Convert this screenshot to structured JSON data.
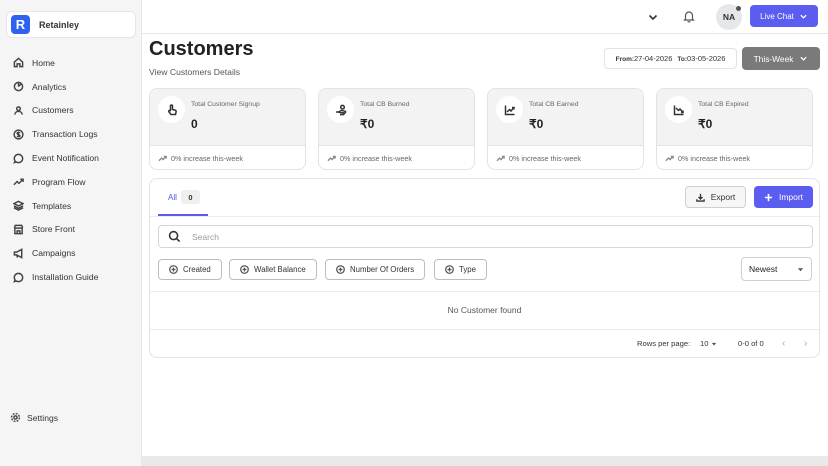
{
  "brand": {
    "name": "Retainley",
    "logo_letter": "R"
  },
  "sidebar": {
    "items": [
      {
        "label": "Home",
        "icon": "home-icon"
      },
      {
        "label": "Analytics",
        "icon": "analytics-icon"
      },
      {
        "label": "Customers",
        "icon": "customers-icon"
      },
      {
        "label": "Transaction Logs",
        "icon": "dollar-circle-icon"
      },
      {
        "label": "Event Notification",
        "icon": "chat-bubble-icon"
      },
      {
        "label": "Program Flow",
        "icon": "trend-icon"
      },
      {
        "label": "Templates",
        "icon": "layers-icon"
      },
      {
        "label": "Store Front",
        "icon": "store-icon"
      },
      {
        "label": "Campaigns",
        "icon": "megaphone-icon"
      },
      {
        "label": "Installation Guide",
        "icon": "chat-bubble-icon"
      }
    ],
    "settings_label": "Settings"
  },
  "topbar": {
    "avatar_initials": "NA",
    "live_chat_label": "Live Chat"
  },
  "header": {
    "title": "Customers",
    "subtitle": "View Customers Details",
    "date_from_label": "From:",
    "date_from": "27-04-2026",
    "date_to_label": "To:",
    "date_to": "03-05-2026",
    "period": "This-Week"
  },
  "stats": [
    {
      "title": "Total Customer Signup",
      "value": "0",
      "footer": "0% increase this-week",
      "icon": "hand-pointer-icon"
    },
    {
      "title": "Total CB Burned",
      "value": "₹0",
      "footer": "0% increase this-week",
      "icon": "hand-coin-icon"
    },
    {
      "title": "Total CB Earned",
      "value": "₹0",
      "footer": "0% increase this-week",
      "icon": "chart-up-icon"
    },
    {
      "title": "Total CB Expired",
      "value": "₹0",
      "footer": "0% increase this-week",
      "icon": "chart-down-icon"
    }
  ],
  "table": {
    "tab_label": "All",
    "tab_count": "0",
    "export_label": "Export",
    "import_label": "Import",
    "search_placeholder": "Search",
    "filters": [
      "Created",
      "Wallet Balance",
      "Number Of Orders",
      "Type"
    ],
    "sort_value": "Newest",
    "empty_message": "No Customer found",
    "rows_per_page_label": "Rows per page:",
    "rows_per_page": "10",
    "range": "0-0 of 0"
  },
  "colors": {
    "accent": "#5b5cf0",
    "brand": "#2f62f0",
    "period_button": "#7a7a7a"
  }
}
